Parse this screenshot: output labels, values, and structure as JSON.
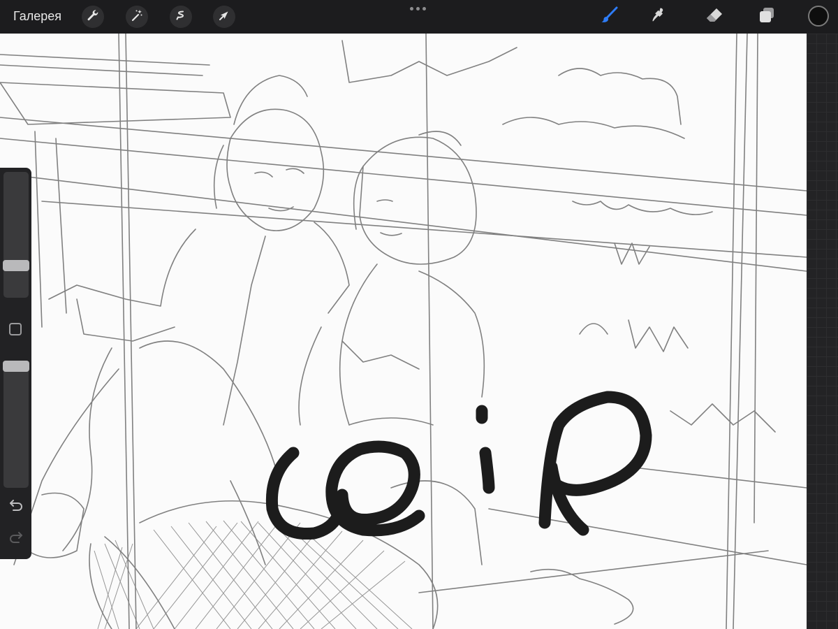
{
  "toolbar": {
    "gallery_label": "Галерея",
    "left_tools": [
      "wrench-icon",
      "magic-wand-icon",
      "selection-icon",
      "transform-arrow-icon"
    ],
    "right_tools": [
      "brush-icon",
      "smudge-icon",
      "eraser-icon",
      "layers-icon"
    ],
    "active_tool": "brush-icon",
    "active_color": "#2e7cf6",
    "current_color": "#0e0e0e"
  },
  "sidebar": {
    "brush_size_level": 0.38,
    "opacity_level": 0.06
  },
  "canvas": {
    "background": "#fbfbfb",
    "lettering": "wip"
  }
}
